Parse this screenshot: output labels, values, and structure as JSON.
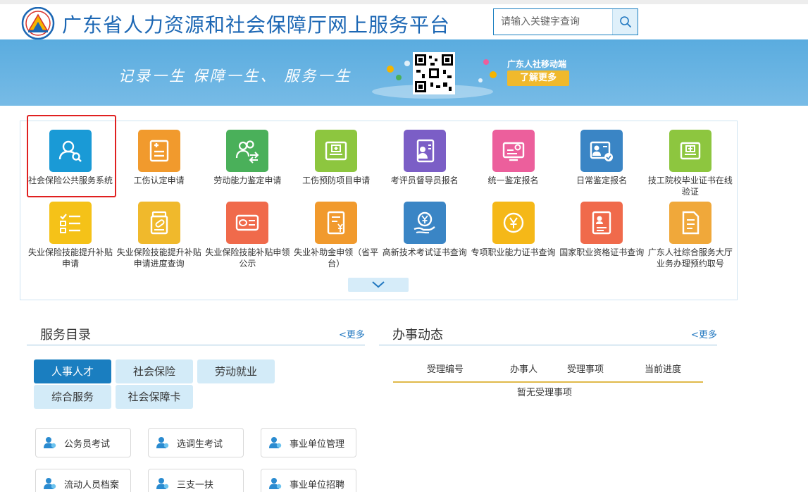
{
  "header": {
    "site_title": "广东省人力资源和社会保障厅网上服务平台",
    "search_placeholder": "请输入关键字查询"
  },
  "banner": {
    "slogan": "记录一生  保障一生、 服务一生",
    "mobile_label": "广东人社移动端",
    "learn_more": "了解更多"
  },
  "services": [
    {
      "label": "社会保险公共服务系统",
      "icon": "user-search-icon",
      "color": "#1a9ad6"
    },
    {
      "label": "工伤认定申请",
      "icon": "document-plus-icon",
      "color": "#f19a2d"
    },
    {
      "label": "劳动能力鉴定申请",
      "icon": "people-exchange-icon",
      "color": "#4ab05a"
    },
    {
      "label": "工伤预防项目申请",
      "icon": "medical-board-icon",
      "color": "#8dc63f"
    },
    {
      "label": "考评员督导员报名",
      "icon": "id-badge-icon",
      "color": "#7b5ec6"
    },
    {
      "label": "统一鉴定报名",
      "icon": "screen-money-icon",
      "color": "#ec5f9c"
    },
    {
      "label": "日常鉴定报名",
      "icon": "id-card-icon",
      "color": "#3a85c5"
    },
    {
      "label": "技工院校毕业证书在线验证",
      "icon": "certificate-icon",
      "color": "#8dc63f"
    },
    {
      "label": "失业保险技能提升补贴申请",
      "icon": "checklist-icon",
      "color": "#f5c218"
    },
    {
      "label": "失业保险技能提升补贴申请进度查询",
      "icon": "medicine-bottle-icon",
      "color": "#f0b92c"
    },
    {
      "label": "失业保险技能补贴申领公示",
      "icon": "card-icon",
      "color": "#f06a4b"
    },
    {
      "label": "失业补助金申领（省平台）",
      "icon": "yen-document-icon",
      "color": "#f19a2d"
    },
    {
      "label": "高新技术考试证书查询",
      "icon": "yen-hand-icon",
      "color": "#3a85c5"
    },
    {
      "label": "专项职业能力证书查询",
      "icon": "yen-coin-icon",
      "color": "#f5b818"
    },
    {
      "label": "国家职业资格证书查询",
      "icon": "profile-document-icon",
      "color": "#f06a4b"
    },
    {
      "label": "广东人社综合服务大厅业务办理预约取号",
      "icon": "document-lines-icon",
      "color": "#f0a83a"
    }
  ],
  "catalog": {
    "title": "服务目录",
    "more": "<更多",
    "tabs": [
      "人事人才",
      "社会保险",
      "劳动就业",
      "综合服务",
      "社会保障卡"
    ],
    "active_tab": "人事人才",
    "items": [
      "公务员考试",
      "选调生考试",
      "事业单位管理",
      "流动人员档案",
      "三支一扶",
      "事业单位招聘"
    ]
  },
  "progress": {
    "title": "办事动态",
    "more": "<更多",
    "columns": [
      "受理编号",
      "办事人",
      "受理事项",
      "当前进度"
    ],
    "empty_text": "暂无受理事项"
  },
  "colors": {
    "brand_blue": "#1c67b4",
    "banner_blue": "#5aacdf",
    "accent_yellow": "#f0b92c",
    "highlight_red": "#e02020"
  }
}
